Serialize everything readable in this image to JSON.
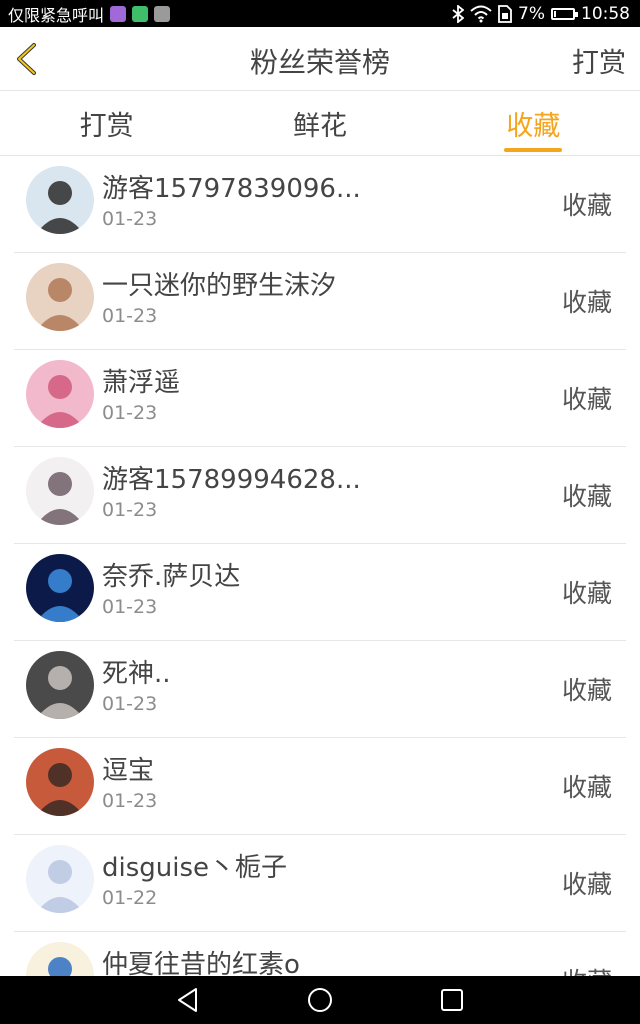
{
  "status_bar": {
    "carrier": "仅限紧急呼叫",
    "battery_percent": "7%",
    "time": "10:58",
    "icons": [
      "app-icon-purple",
      "app-icon-green",
      "app-icon-gray",
      "bluetooth-icon",
      "wifi-icon",
      "sim-icon",
      "battery-icon"
    ]
  },
  "header": {
    "back_icon": "chevron-left-icon",
    "title": "粉丝荣誉榜",
    "right_action": "打赏",
    "accent_color": "#f5a41e"
  },
  "tabs": [
    {
      "label": "打赏",
      "active": false
    },
    {
      "label": "鲜花",
      "active": false
    },
    {
      "label": "收藏",
      "active": true
    }
  ],
  "list": [
    {
      "name": "游客15797839096...",
      "date": "01-23",
      "action": "收藏",
      "avatar_bg": "#d9e6ef",
      "avatar_fg": "#2a2a2a"
    },
    {
      "name": "一只迷你的野生沫汐",
      "date": "01-23",
      "action": "收藏",
      "avatar_bg": "#e8d2c2",
      "avatar_fg": "#b07a57"
    },
    {
      "name": "萧浮遥",
      "date": "01-23",
      "action": "收藏",
      "avatar_bg": "#f2b8cc",
      "avatar_fg": "#d15b7c"
    },
    {
      "name": "游客15789994628...",
      "date": "01-23",
      "action": "收藏",
      "avatar_bg": "#f3f0f2",
      "avatar_fg": "#6e5d66"
    },
    {
      "name": "奈乔.萨贝达",
      "date": "01-23",
      "action": "收藏",
      "avatar_bg": "#0c1a4a",
      "avatar_fg": "#3d8fe0"
    },
    {
      "name": "死神..",
      "date": "01-23",
      "action": "收藏",
      "avatar_bg": "#4a4a4a",
      "avatar_fg": "#c9c2bd"
    },
    {
      "name": "逗宝",
      "date": "01-23",
      "action": "收藏",
      "avatar_bg": "#c85a3c",
      "avatar_fg": "#3a2a24"
    },
    {
      "name": "disguise丶栀子",
      "date": "01-22",
      "action": "收藏",
      "avatar_bg": "#eef2fa",
      "avatar_fg": "#b8c6e0"
    },
    {
      "name": "仲夏往昔的红素o",
      "date": "",
      "action": "收藏",
      "avatar_bg": "#f7f1dd",
      "avatar_fg": "#2f6fc2"
    }
  ],
  "nav_bar": {
    "icons": [
      "back-triangle-icon",
      "home-circle-icon",
      "recents-square-icon"
    ]
  }
}
